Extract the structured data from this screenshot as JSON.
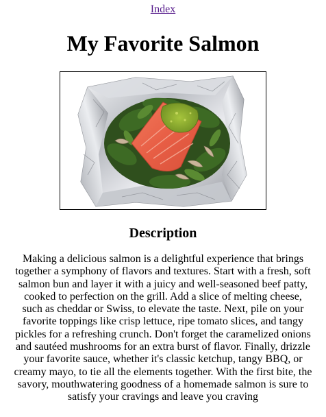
{
  "nav": {
    "index_link": "Index",
    "link_color": "#551a8b"
  },
  "page": {
    "title": "My Favorite Salmon"
  },
  "image": {
    "subject": "salmon fillet with pesto on spinach in foil packet"
  },
  "description": {
    "heading": "Description",
    "body": "Making a delicious salmon is a delightful experience that brings together a symphony of flavors and textures. Start with a fresh, soft salmon bun and layer it with a juicy and well-seasoned beef patty, cooked to perfection on the grill. Add a slice of melting cheese, such as cheddar or Swiss, to elevate the taste. Next, pile on your favorite toppings like crisp lettuce, ripe tomato slices, and tangy pickles for a refreshing crunch. Don't forget the caramelized onions and sautéed mushrooms for an extra burst of flavor. Finally, drizzle your favorite sauce, whether it's classic ketchup, tangy BBQ, or creamy mayo, to tie all the elements together. With the first bite, the savory, mouthwatering goodness of a homemade salmon is sure to satisfy your cravings and leave you craving"
  }
}
